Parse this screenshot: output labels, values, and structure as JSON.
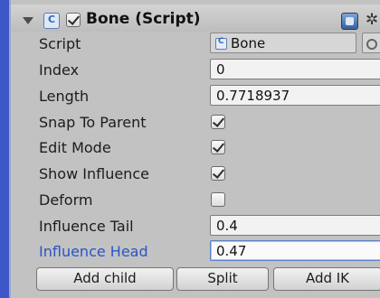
{
  "component": {
    "title": "Bone (Script)",
    "enabled": true
  },
  "fields": {
    "script": {
      "label": "Script",
      "value": "Bone"
    },
    "index": {
      "label": "Index",
      "value": "0"
    },
    "length": {
      "label": "Length",
      "value": "0.7718937"
    },
    "snap_to_parent": {
      "label": "Snap To Parent",
      "checked": true
    },
    "edit_mode": {
      "label": "Edit Mode",
      "checked": true
    },
    "show_influence": {
      "label": "Show Influence",
      "checked": true
    },
    "deform": {
      "label": "Deform",
      "checked": false
    },
    "influence_tail": {
      "label": "Influence Tail",
      "value": "0.4"
    },
    "influence_head": {
      "label": "Influence Head",
      "value": "0.47"
    }
  },
  "buttons": {
    "add_child": "Add child",
    "split": "Split",
    "add_ik": "Add IK"
  },
  "icons": {
    "foldout": "triangle-down-icon",
    "script_component": "csharp-script-icon",
    "help": "reference-help-icon",
    "settings": "gear-icon"
  },
  "colors": {
    "inspector_background": "#c2c2c2",
    "active_label": "#2a55c4",
    "backdrop": "#3d56c8"
  }
}
